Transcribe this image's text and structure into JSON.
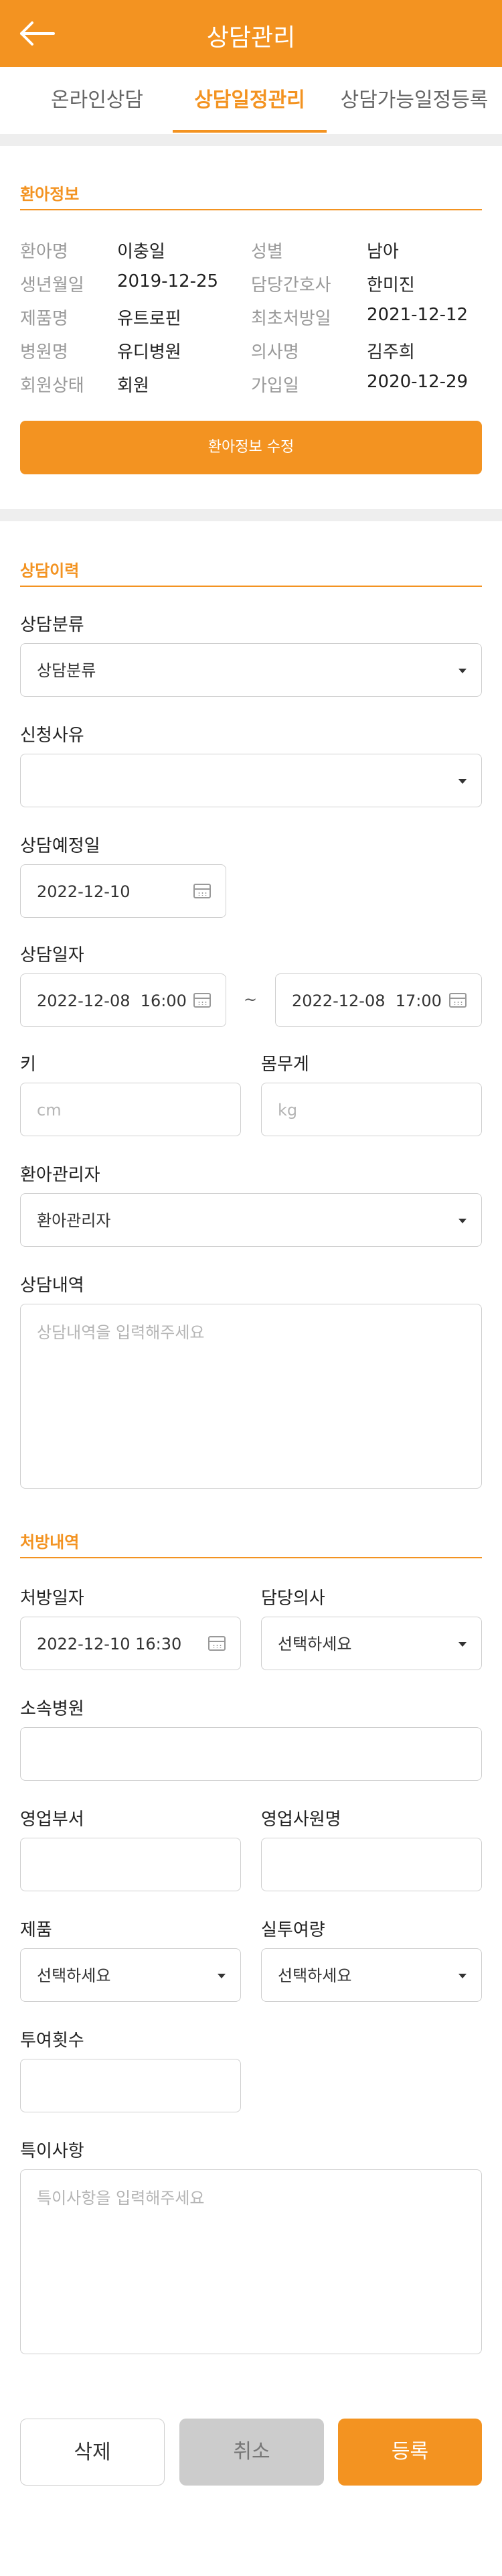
{
  "header": {
    "title": "상담관리",
    "back_icon": "arrow-left-icon",
    "color": "#f39321"
  },
  "tabs": [
    {
      "label": "온라인상담",
      "active": false
    },
    {
      "label": "상담일정관리",
      "active": true
    },
    {
      "label": "상담가능일정등록",
      "active": false
    }
  ],
  "patient_info": {
    "title": "환아정보",
    "rows": [
      {
        "l1": "환아명",
        "v1": "이충일",
        "l2": "성별",
        "v2": "남아"
      },
      {
        "l1": "생년월일",
        "v1": "2019-12-25",
        "l2": "담당간호사",
        "v2": "한미진"
      },
      {
        "l1": "제품명",
        "v1": "유트로핀",
        "l2": "최초처방일",
        "v2": "2021-12-12"
      },
      {
        "l1": "병원명",
        "v1": "유디병원",
        "l2": "의사명",
        "v2": "김주희"
      },
      {
        "l1": "회원상태",
        "v1": "회원",
        "l2": "가입일",
        "v2": "2020-12-29"
      }
    ],
    "edit_button": "환아정보 수정"
  },
  "consult": {
    "title": "상담이력",
    "category_label": "상담분류",
    "category_value": "상담분류",
    "reason_label": "신청사유",
    "reason_value": "",
    "scheduled_label": "상담예정일",
    "scheduled_value": "2022-12-10",
    "date_label": "상담일자",
    "date_from": "2022-12-08  16:00",
    "date_sep": "~",
    "date_to": "2022-12-08  17:00",
    "height_label": "키",
    "height_placeholder": "cm",
    "weight_label": "몸무게",
    "weight_placeholder": "kg",
    "manager_label": "환아관리자",
    "manager_value": "환아관리자",
    "content_label": "상담내역",
    "content_placeholder": "상담내역을 입력해주세요"
  },
  "prescription": {
    "title": "처방내역",
    "date_label": "처방일자",
    "date_value": "2022-12-10 16:30",
    "doctor_label": "담당의사",
    "doctor_value": "선택하세요",
    "hospital_label": "소속병원",
    "dept_label": "영업부서",
    "rep_label": "영업사원명",
    "product_label": "제품",
    "product_value": "선택하세요",
    "dose_label": "실투여량",
    "dose_value": "선택하세요",
    "count_label": "투여횟수",
    "notes_label": "특이사항",
    "notes_placeholder": "특이사항을 입력해주세요"
  },
  "actions": {
    "delete": "삭제",
    "cancel": "취소",
    "register": "등록"
  }
}
